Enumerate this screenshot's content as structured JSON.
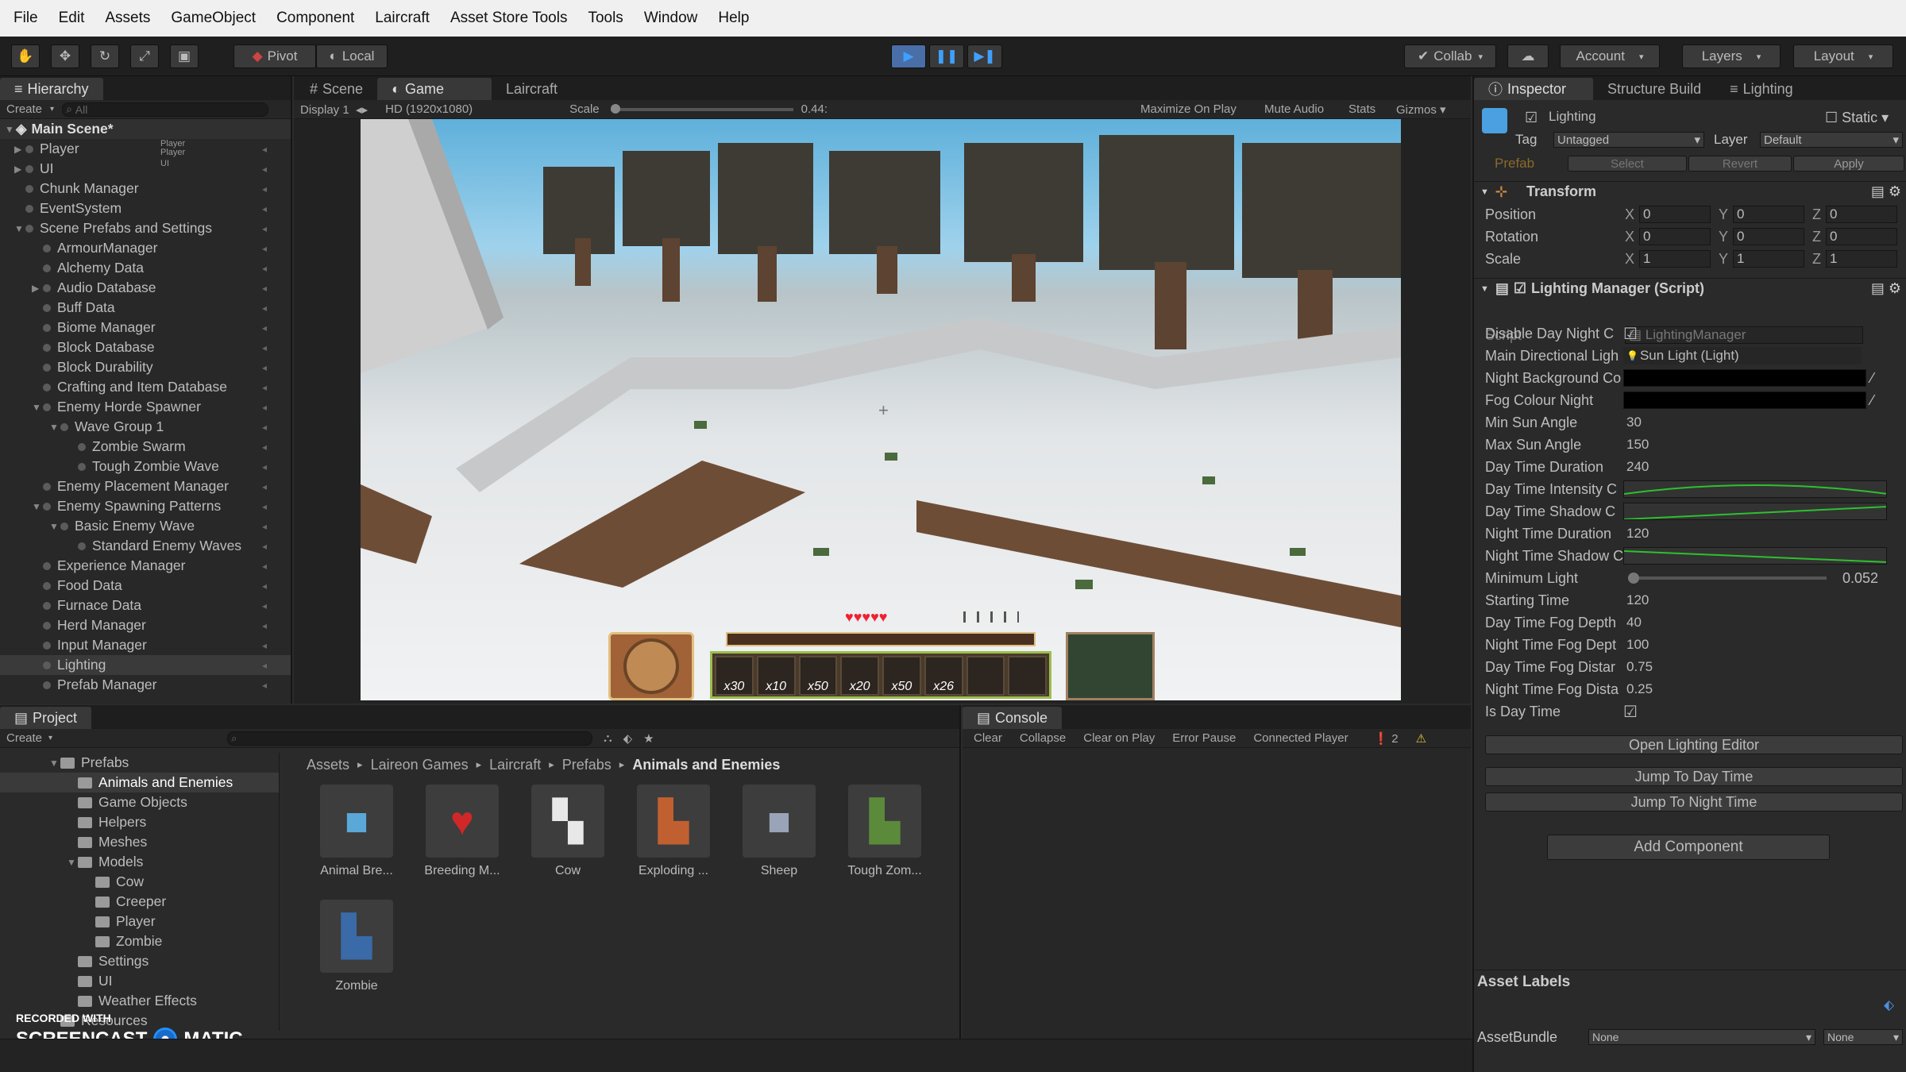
{
  "menu": [
    "File",
    "Edit",
    "Assets",
    "GameObject",
    "Component",
    "Laircraft",
    "Asset Store Tools",
    "Tools",
    "Window",
    "Help"
  ],
  "toolbar": {
    "pivot": "Pivot",
    "local": "Local",
    "collab": "Collab",
    "account": "Account",
    "layers": "Layers",
    "layout": "Layout"
  },
  "hierarchy": {
    "tab": "Hierarchy",
    "create": "Create",
    "search": "All",
    "scene": "Main Scene*",
    "items": [
      {
        "label": "Player",
        "depth": 0,
        "arrow": "▶",
        "tag": "Player\nPlayer"
      },
      {
        "label": "UI",
        "depth": 0,
        "arrow": "▶",
        "tag": "UI"
      },
      {
        "label": "Chunk Manager",
        "depth": 0,
        "arrow": ""
      },
      {
        "label": "EventSystem",
        "depth": 0,
        "arrow": ""
      },
      {
        "label": "Scene Prefabs and Settings",
        "depth": 0,
        "arrow": "▼"
      },
      {
        "label": "ArmourManager",
        "depth": 1,
        "arrow": ""
      },
      {
        "label": "Alchemy Data",
        "depth": 1,
        "arrow": ""
      },
      {
        "label": "Audio Database",
        "depth": 1,
        "arrow": "▶"
      },
      {
        "label": "Buff Data",
        "depth": 1,
        "arrow": ""
      },
      {
        "label": "Biome Manager",
        "depth": 1,
        "arrow": ""
      },
      {
        "label": "Block Database",
        "depth": 1,
        "arrow": ""
      },
      {
        "label": "Block Durability",
        "depth": 1,
        "arrow": ""
      },
      {
        "label": "Crafting and Item Database",
        "depth": 1,
        "arrow": ""
      },
      {
        "label": "Enemy Horde Spawner",
        "depth": 1,
        "arrow": "▼"
      },
      {
        "label": "Wave Group 1",
        "depth": 2,
        "arrow": "▼"
      },
      {
        "label": "Zombie Swarm",
        "depth": 3,
        "arrow": ""
      },
      {
        "label": "Tough Zombie Wave",
        "depth": 3,
        "arrow": ""
      },
      {
        "label": "Enemy Placement Manager",
        "depth": 1,
        "arrow": ""
      },
      {
        "label": "Enemy Spawning Patterns",
        "depth": 1,
        "arrow": "▼"
      },
      {
        "label": "Basic Enemy Wave",
        "depth": 2,
        "arrow": "▼"
      },
      {
        "label": "Standard Enemy Waves",
        "depth": 3,
        "arrow": ""
      },
      {
        "label": "Experience Manager",
        "depth": 1,
        "arrow": ""
      },
      {
        "label": "Food Data",
        "depth": 1,
        "arrow": ""
      },
      {
        "label": "Furnace Data",
        "depth": 1,
        "arrow": ""
      },
      {
        "label": "Herd Manager",
        "depth": 1,
        "arrow": ""
      },
      {
        "label": "Input Manager",
        "depth": 1,
        "arrow": ""
      },
      {
        "label": "Lighting",
        "depth": 1,
        "arrow": ""
      },
      {
        "label": "Prefab Manager",
        "depth": 1,
        "arrow": ""
      }
    ]
  },
  "center": {
    "tabs": [
      "Scene",
      "Game",
      "Laircraft"
    ],
    "display": "Display 1",
    "resolution": "HD (1920x1080)",
    "scale_label": "Scale",
    "scale_value": "0.44:",
    "options": [
      "Maximize On Play",
      "Mute Audio",
      "Stats",
      "Gizmos"
    ],
    "hud_slots": [
      "x30",
      "x10",
      "x50",
      "x20",
      "x50",
      "x26",
      "",
      ""
    ]
  },
  "inspector": {
    "tabs": [
      "Inspector",
      "Structure Build",
      "Lighting"
    ],
    "object_name": "Lighting",
    "static": "Static",
    "tag_label": "Tag",
    "tag": "Untagged",
    "layer_label": "Layer",
    "layer": "Default",
    "prefab": "Prefab",
    "select": "Select",
    "revert": "Revert",
    "apply": "Apply",
    "transform_title": "Transform",
    "transform": [
      {
        "label": "Position",
        "x": "0",
        "y": "0",
        "z": "0"
      },
      {
        "label": "Rotation",
        "x": "0",
        "y": "0",
        "z": "0"
      },
      {
        "label": "Scale",
        "x": "1",
        "y": "1",
        "z": "1"
      }
    ],
    "script_title": "Lighting Manager (Script)",
    "script_label": "Script",
    "script_value": "LightingManager",
    "props": [
      {
        "label": "Disable Day Night C",
        "type": "check"
      },
      {
        "label": "Main Directional Ligh",
        "type": "text",
        "value": "Sun Light (Light)"
      },
      {
        "label": "Night Background Co",
        "type": "color"
      },
      {
        "label": "Fog Colour Night",
        "type": "color"
      },
      {
        "label": "Min Sun Angle",
        "type": "text",
        "value": "30"
      },
      {
        "label": "Max Sun Angle",
        "type": "text",
        "value": "150"
      },
      {
        "label": "Day Time Duration",
        "type": "text",
        "value": "240"
      },
      {
        "label": "Day Time Intensity C",
        "type": "curve"
      },
      {
        "label": "Day Time Shadow C",
        "type": "curve2"
      },
      {
        "label": "Night Time Duration",
        "type": "text",
        "value": "120"
      },
      {
        "label": "Night Time Shadow C",
        "type": "curve3"
      },
      {
        "label": "Minimum Light",
        "type": "slider",
        "value": "0.052"
      },
      {
        "label": "Starting Time",
        "type": "text",
        "value": "120"
      },
      {
        "label": "Day Time Fog Depth",
        "type": "text",
        "value": "40"
      },
      {
        "label": "Night Time Fog Dept",
        "type": "text",
        "value": "100"
      },
      {
        "label": "Day Time Fog Distar",
        "type": "text",
        "value": "0.75"
      },
      {
        "label": "Night Time Fog Dista",
        "type": "text",
        "value": "0.25"
      },
      {
        "label": "Is Day Time",
        "type": "check"
      }
    ],
    "buttons": [
      "Open Lighting Editor",
      "Jump To Day Time",
      "Jump To Night Time"
    ],
    "add_component": "Add Component",
    "asset_labels": "Asset Labels",
    "asset_bundle": "AssetBundle",
    "bundle_value": "None",
    "bundle_variant": "None"
  },
  "project": {
    "tab": "Project",
    "create": "Create",
    "breadcrumb": [
      "Assets",
      "Laireon Games",
      "Laircraft",
      "Prefabs",
      "Animals and Enemies"
    ],
    "folders": [
      {
        "label": "Prefabs",
        "depth": 0,
        "arrow": "▼"
      },
      {
        "label": "Animals and Enemies",
        "depth": 1,
        "arrow": "",
        "selected": true
      },
      {
        "label": "Game Objects",
        "depth": 1,
        "arrow": ""
      },
      {
        "label": "Helpers",
        "depth": 1,
        "arrow": ""
      },
      {
        "label": "Meshes",
        "depth": 1,
        "arrow": ""
      },
      {
        "label": "Models",
        "depth": 1,
        "arrow": "▼"
      },
      {
        "label": "Cow",
        "depth": 2,
        "arrow": ""
      },
      {
        "label": "Creeper",
        "depth": 2,
        "arrow": ""
      },
      {
        "label": "Player",
        "depth": 2,
        "arrow": ""
      },
      {
        "label": "Zombie",
        "depth": 2,
        "arrow": ""
      },
      {
        "label": "Settings",
        "depth": 1,
        "arrow": ""
      },
      {
        "label": "UI",
        "depth": 1,
        "arrow": ""
      },
      {
        "label": "Weather Effects",
        "depth": 1,
        "arrow": ""
      },
      {
        "label": "Resources",
        "depth": 0,
        "arrow": ""
      }
    ],
    "assets": [
      {
        "label": "Animal Bre...",
        "icon": "■",
        "color": "#5aa8d8"
      },
      {
        "label": "Breeding M...",
        "icon": "♥",
        "color": "#d02828"
      },
      {
        "label": "Cow",
        "icon": "▚",
        "color": "#e8e8e8"
      },
      {
        "label": "Exploding ...",
        "icon": "▙",
        "color": "#c06030"
      },
      {
        "label": "Sheep",
        "icon": "■",
        "color": "#9aa4b8"
      },
      {
        "label": "Tough Zom...",
        "icon": "▙",
        "color": "#5b8a3a"
      },
      {
        "label": "Zombie",
        "icon": "▙",
        "color": "#3a6aa8"
      }
    ]
  },
  "console": {
    "tab": "Console",
    "buttons": [
      "Clear",
      "Collapse",
      "Clear on Play",
      "Error Pause",
      "Connected Player"
    ],
    "count": "2"
  },
  "watermark": {
    "top": "RECORDED WITH",
    "brand1": "SCREENCAST",
    "brand2": "MATIC"
  }
}
